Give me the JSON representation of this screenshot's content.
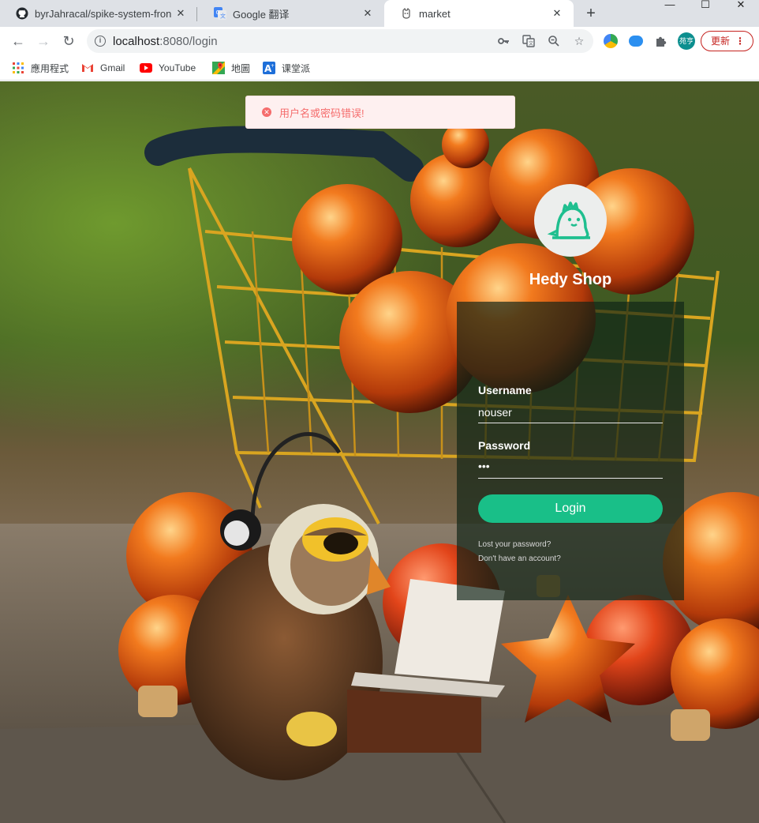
{
  "browser": {
    "tabs": [
      {
        "title": "byrJahracal/spike-system-fron",
        "icon": "github-icon"
      },
      {
        "title": "Google 翻译",
        "icon": "google-translate-icon"
      },
      {
        "title": "market",
        "icon": "market-favicon"
      }
    ],
    "window_controls": {
      "minimize": "—",
      "maximize": "☐",
      "close": "✕"
    },
    "address": {
      "host": "localhost",
      "path": ":8080/login"
    },
    "avatar_text": "苑亨",
    "update_label": "更新"
  },
  "bookmarks": [
    {
      "label": "應用程式",
      "icon": "apps-grid-icon"
    },
    {
      "label": "Gmail",
      "icon": "gmail-icon"
    },
    {
      "label": "YouTube",
      "icon": "youtube-icon"
    },
    {
      "label": "地圖",
      "icon": "maps-icon"
    },
    {
      "label": "课堂派",
      "icon": "ketangpai-icon"
    }
  ],
  "alert": {
    "message": "用户名或密码错误!",
    "color": "#f56c6c"
  },
  "login": {
    "shop_name": "Hedy Shop",
    "username_label": "Username",
    "username_value": "nouser",
    "password_label": "Password",
    "password_value": "•••",
    "button_label": "Login",
    "lost_password": "Lost your password?",
    "no_account": "Don't have an account?",
    "accent": "#19bf88"
  }
}
